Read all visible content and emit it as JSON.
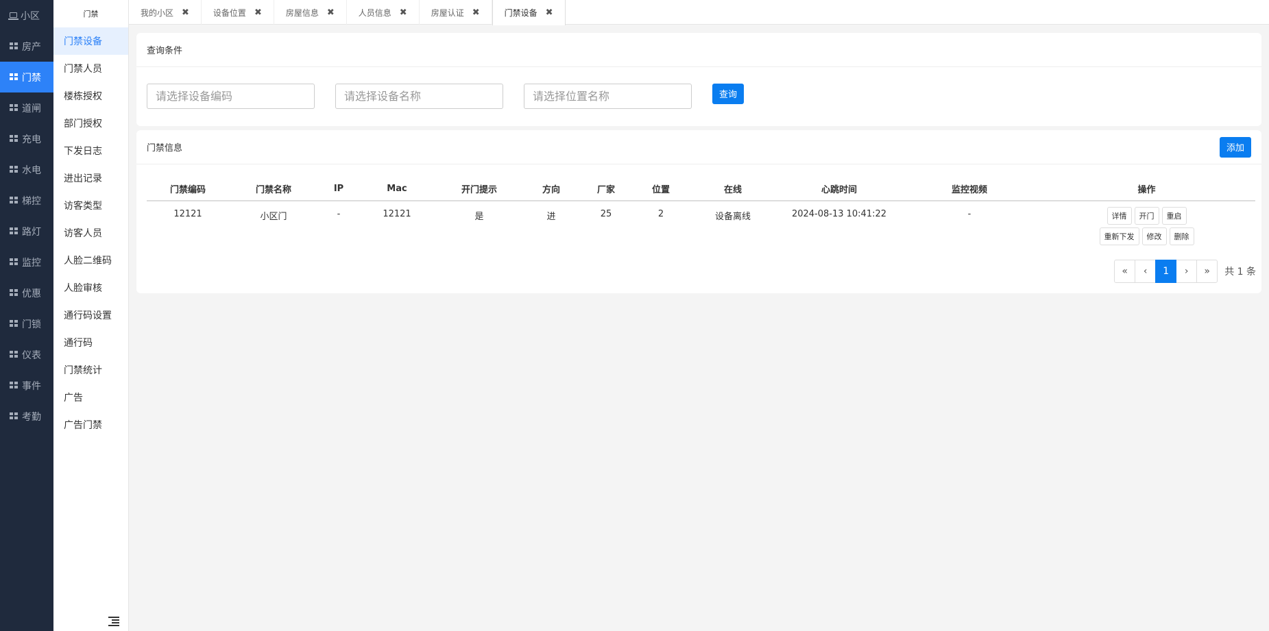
{
  "rail": {
    "items": [
      {
        "label": "小区",
        "icon": "laptop-icon",
        "active": false
      },
      {
        "label": "房产",
        "icon": "grid-icon",
        "active": false
      },
      {
        "label": "门禁",
        "icon": "grid-icon",
        "active": true
      },
      {
        "label": "道闸",
        "icon": "grid-icon",
        "active": false
      },
      {
        "label": "充电",
        "icon": "grid-icon",
        "active": false
      },
      {
        "label": "水电",
        "icon": "grid-icon",
        "active": false
      },
      {
        "label": "梯控",
        "icon": "grid-icon",
        "active": false
      },
      {
        "label": "路灯",
        "icon": "grid-icon",
        "active": false
      },
      {
        "label": "监控",
        "icon": "grid-icon",
        "active": false
      },
      {
        "label": "优惠",
        "icon": "grid-icon",
        "active": false
      },
      {
        "label": "门锁",
        "icon": "grid-icon",
        "active": false
      },
      {
        "label": "仪表",
        "icon": "grid-icon",
        "active": false
      },
      {
        "label": "事件",
        "icon": "grid-icon",
        "active": false
      },
      {
        "label": "考勤",
        "icon": "grid-icon",
        "active": false
      }
    ]
  },
  "submenu": {
    "title": "门禁",
    "items": [
      {
        "label": "门禁设备",
        "active": true
      },
      {
        "label": "门禁人员",
        "active": false
      },
      {
        "label": "楼栋授权",
        "active": false
      },
      {
        "label": "部门授权",
        "active": false
      },
      {
        "label": "下发日志",
        "active": false
      },
      {
        "label": "进出记录",
        "active": false
      },
      {
        "label": "访客类型",
        "active": false
      },
      {
        "label": "访客人员",
        "active": false
      },
      {
        "label": "人脸二维码",
        "active": false
      },
      {
        "label": "人脸审核",
        "active": false
      },
      {
        "label": "通行码设置",
        "active": false
      },
      {
        "label": "通行码",
        "active": false
      },
      {
        "label": "门禁统计",
        "active": false
      },
      {
        "label": "广告",
        "active": false
      },
      {
        "label": "广告门禁",
        "active": false
      }
    ]
  },
  "tabs": [
    {
      "label": "我的小区",
      "active": false
    },
    {
      "label": "设备位置",
      "active": false
    },
    {
      "label": "房屋信息",
      "active": false
    },
    {
      "label": "人员信息",
      "active": false
    },
    {
      "label": "房屋认证",
      "active": false
    },
    {
      "label": "门禁设备",
      "active": true
    }
  ],
  "query": {
    "title": "查询条件",
    "inputs": [
      {
        "name": "device-code-input",
        "placeholder": "请选择设备编码"
      },
      {
        "name": "device-name-input",
        "placeholder": "请选择设备名称"
      },
      {
        "name": "location-name-input",
        "placeholder": "请选择位置名称"
      }
    ],
    "search_label": "查询"
  },
  "info": {
    "title": "门禁信息",
    "add_label": "添加",
    "columns": [
      "门禁编码",
      "门禁名称",
      "IP",
      "Mac",
      "开门提示",
      "方向",
      "厂家",
      "位置",
      "在线",
      "心跳时间",
      "监控视频",
      "操作"
    ],
    "rows": [
      {
        "cells": [
          "12121",
          "小区门",
          "-",
          "12121",
          "是",
          "进",
          "25",
          "2",
          "设备离线",
          "2024-08-13 10:41:22",
          "-"
        ],
        "actions_row1": [
          "详情",
          "开门",
          "重启"
        ],
        "actions_row2": [
          "重新下发",
          "修改",
          "删除"
        ]
      }
    ],
    "pager": {
      "first": "«",
      "prev": "‹",
      "current": "1",
      "next": "›",
      "last": "»",
      "total": "共 1 条"
    }
  },
  "colors": {
    "primary": "#0a7df0",
    "rail_bg": "#1f2a3d",
    "rail_active": "#2d82f8"
  }
}
